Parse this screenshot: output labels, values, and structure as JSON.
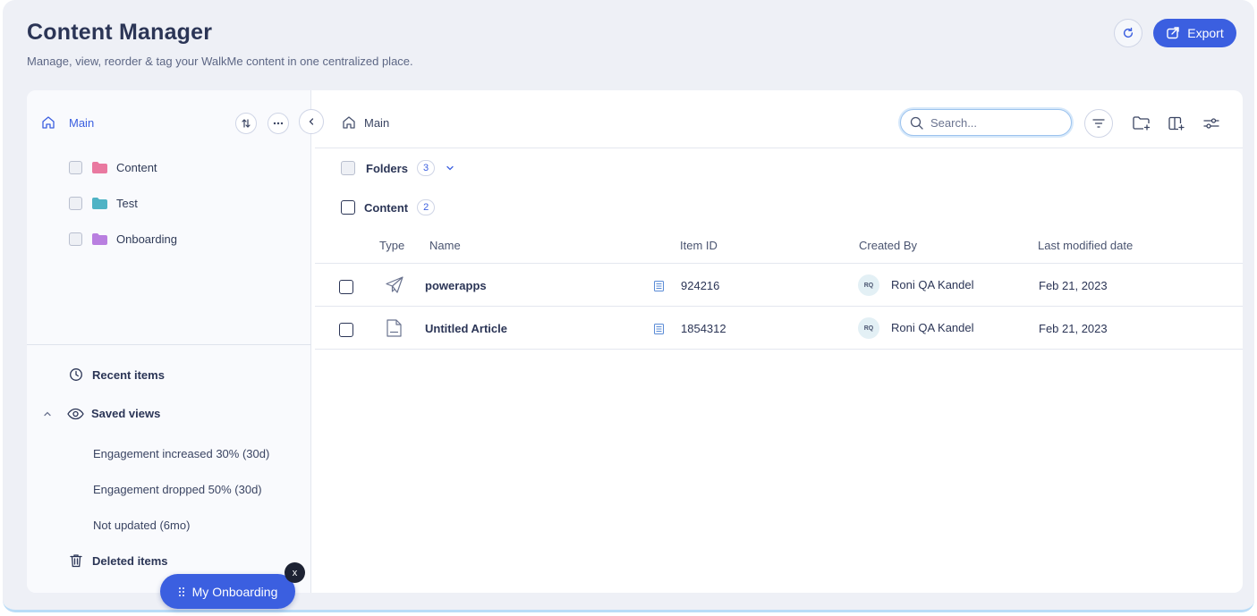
{
  "header": {
    "title": "Content Manager",
    "subtitle": "Manage, view, reorder & tag your WalkMe content in one centralized place.",
    "export_label": "Export"
  },
  "sidebar": {
    "root_label": "Main",
    "folders": [
      {
        "label": "Content",
        "color": "#e979a0"
      },
      {
        "label": "Test",
        "color": "#4fb3c5"
      },
      {
        "label": "Onboarding",
        "color": "#b97fe0"
      }
    ],
    "recent_label": "Recent items",
    "saved_views_label": "Saved views",
    "saved_views": [
      "Engagement increased 30% (30d)",
      "Engagement dropped 50% (30d)",
      "Not updated (6mo)"
    ],
    "deleted_label": "Deleted items"
  },
  "main": {
    "breadcrumb": "Main",
    "search_placeholder": "Search...",
    "folders_section": {
      "label": "Folders",
      "count": "3"
    },
    "content_section": {
      "label": "Content",
      "count": "2"
    },
    "columns": {
      "type": "Type",
      "name": "Name",
      "item_id": "Item ID",
      "created_by": "Created By",
      "modified": "Last modified date"
    },
    "rows": [
      {
        "type_icon": "launcher-icon",
        "name": "powerapps",
        "item_id": "924216",
        "initials": "RQ",
        "creator": "Roni QA Kandel",
        "modified": "Feb 21, 2023"
      },
      {
        "type_icon": "article-icon",
        "name": "Untitled Article",
        "item_id": "1854312",
        "initials": "RQ",
        "creator": "Roni QA Kandel",
        "modified": "Feb 21, 2023"
      }
    ]
  },
  "onboarding_widget": {
    "label": "My Onboarding",
    "close_label": "x"
  },
  "colors": {
    "accent": "#3b5fe0",
    "background": "#eef0f6"
  }
}
